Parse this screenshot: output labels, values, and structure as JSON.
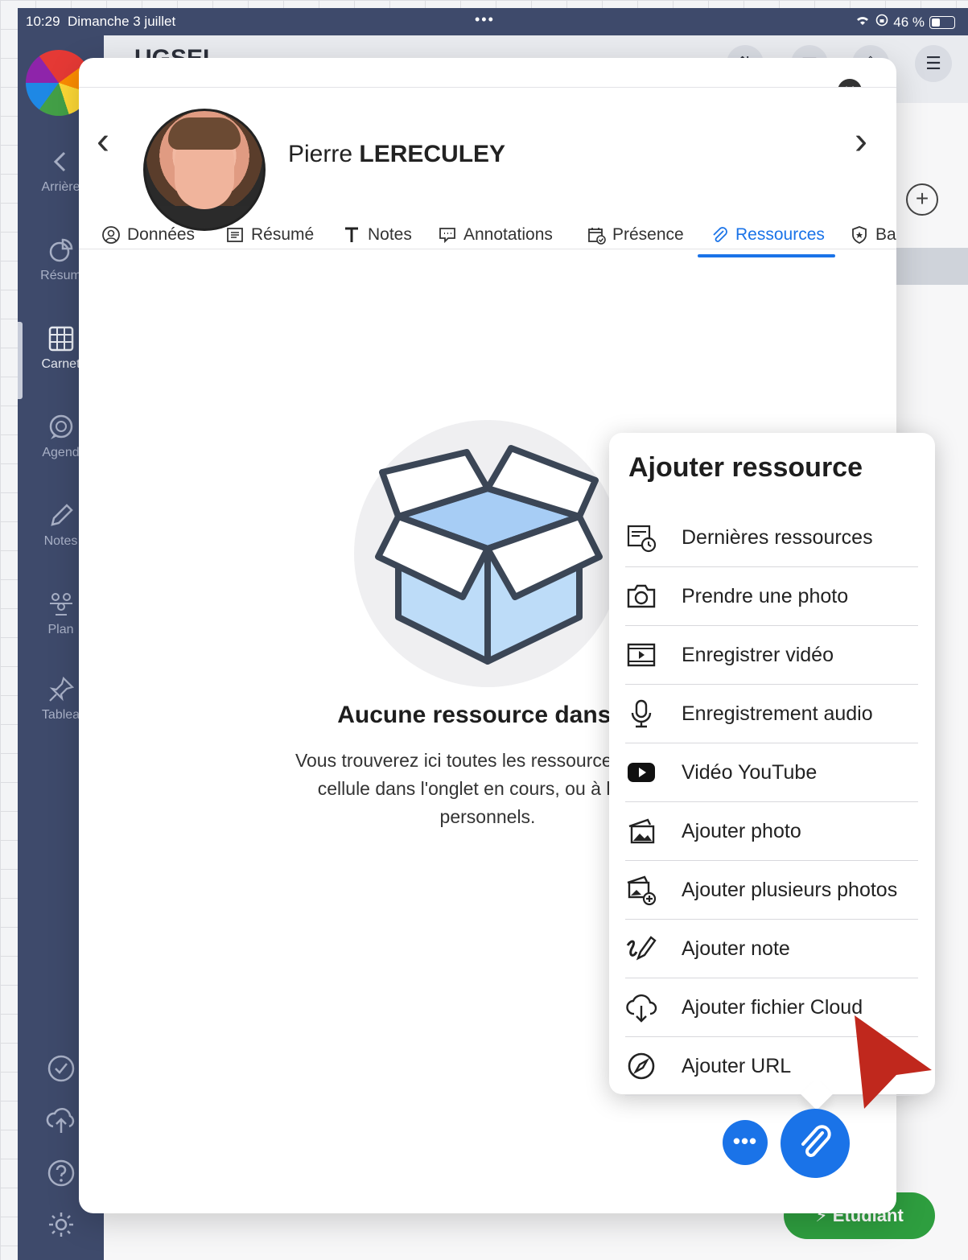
{
  "status_bar": {
    "time": "10:29",
    "date": "Dimanche 3 juillet",
    "battery": "46 %"
  },
  "topbar": {
    "title": "UGSEL"
  },
  "sidebar": {
    "items": [
      {
        "label": "Arrière",
        "icon": "chevron-left-icon"
      },
      {
        "label": "Résum",
        "icon": "pie-chart-icon"
      },
      {
        "label": "Carnet",
        "icon": "grid-icon"
      },
      {
        "label": "Agend",
        "icon": "calendar-chat-icon"
      },
      {
        "label": "Notes",
        "icon": "pencil-icon"
      },
      {
        "label": "Plan",
        "icon": "people-icon"
      },
      {
        "label": "Tablea",
        "icon": "pin-icon"
      }
    ]
  },
  "student": {
    "first_name": "Pierre",
    "last_name": "LERECULEY"
  },
  "tabs": [
    {
      "label": "Données",
      "icon": "person-circle-icon"
    },
    {
      "label": "Résumé",
      "icon": "list-box-icon"
    },
    {
      "label": "Notes",
      "icon": "text-t-icon"
    },
    {
      "label": "Annotations",
      "icon": "comment-icon"
    },
    {
      "label": "Présence",
      "icon": "calendar-check-icon"
    },
    {
      "label": "Ressources",
      "icon": "paperclip-icon",
      "active": true
    },
    {
      "label": "Ba",
      "icon": "shield-badge-icon"
    }
  ],
  "empty_state": {
    "title": "Aucune ressource dans la",
    "line1": "Vous trouverez ici toutes les ressources liées à",
    "line2": "cellule dans l'onglet en cours, ou à leurs r",
    "line3": "personnels."
  },
  "popover": {
    "title": "Ajouter ressource",
    "items": [
      {
        "label": "Dernières ressources",
        "icon": "recent-resources-icon"
      },
      {
        "label": "Prendre une photo",
        "icon": "camera-icon"
      },
      {
        "label": "Enregistrer vidéo",
        "icon": "video-film-icon"
      },
      {
        "label": "Enregistrement audio",
        "icon": "microphone-icon"
      },
      {
        "label": "Vidéo YouTube",
        "icon": "youtube-icon"
      },
      {
        "label": "Ajouter photo",
        "icon": "photo-icon"
      },
      {
        "label": "Ajouter plusieurs photos",
        "icon": "photos-add-icon"
      },
      {
        "label": "Ajouter note",
        "icon": "handwriting-icon"
      },
      {
        "label": "Ajouter fichier Cloud",
        "icon": "cloud-download-icon"
      },
      {
        "label": "Ajouter URL",
        "icon": "compass-icon"
      }
    ]
  },
  "floating": {
    "more_label": "•••",
    "student_button": "Étudiant"
  },
  "colors": {
    "accent": "#1a73e8",
    "sidebar": "#3e4a6b",
    "annotation_arrow": "#c0281d",
    "student_button": "#2e9e3f"
  }
}
